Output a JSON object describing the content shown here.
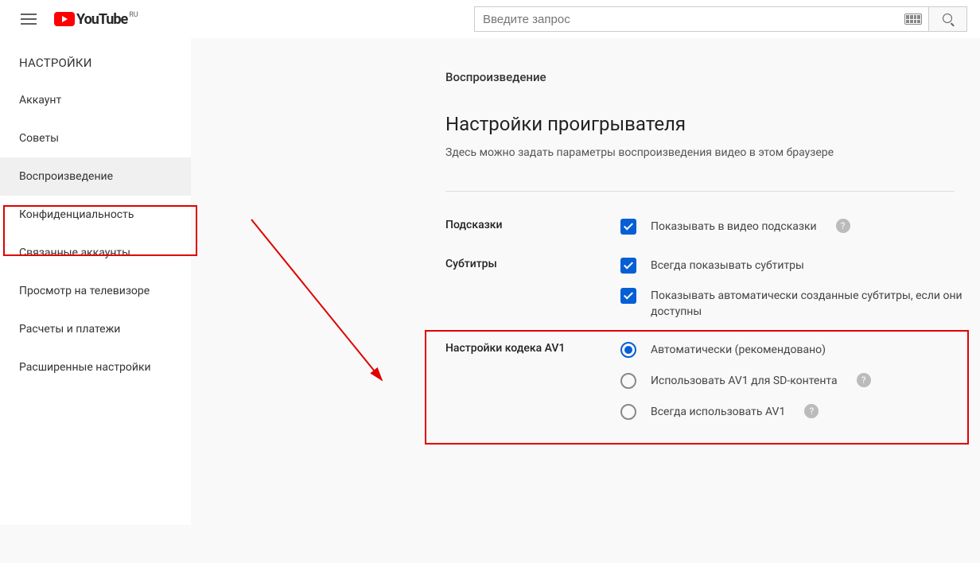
{
  "header": {
    "logo_text": "YouTube",
    "country": "RU",
    "search_placeholder": "Введите запрос"
  },
  "sidebar": {
    "title": "НАСТРОЙКИ",
    "items": [
      {
        "label": "Аккаунт"
      },
      {
        "label": "Советы"
      },
      {
        "label": "Воспроизведение"
      },
      {
        "label": "Конфиденциальность"
      },
      {
        "label": "Связанные аккаунты"
      },
      {
        "label": "Просмотр на телевизоре"
      },
      {
        "label": "Расчеты и платежи"
      },
      {
        "label": "Расширенные настройки"
      }
    ],
    "active_index": 2
  },
  "main": {
    "breadcrumb": "Воспроизведение",
    "title": "Настройки проигрывателя",
    "desc": "Здесь можно задать параметры воспроизведения видео в этом браузере",
    "sections": {
      "hints": {
        "label": "Подсказки",
        "option": "Показывать в видео подсказки"
      },
      "subtitles": {
        "label": "Субтитры",
        "option1": "Всегда показывать субтитры",
        "option2": "Показывать автоматически созданные субтитры, если они доступны"
      },
      "av1": {
        "label": "Настройки кодека AV1",
        "option1": "Автоматически (рекомендовано)",
        "option2": "Использовать AV1 для SD-контента",
        "option3": "Всегда использовать AV1"
      }
    }
  }
}
